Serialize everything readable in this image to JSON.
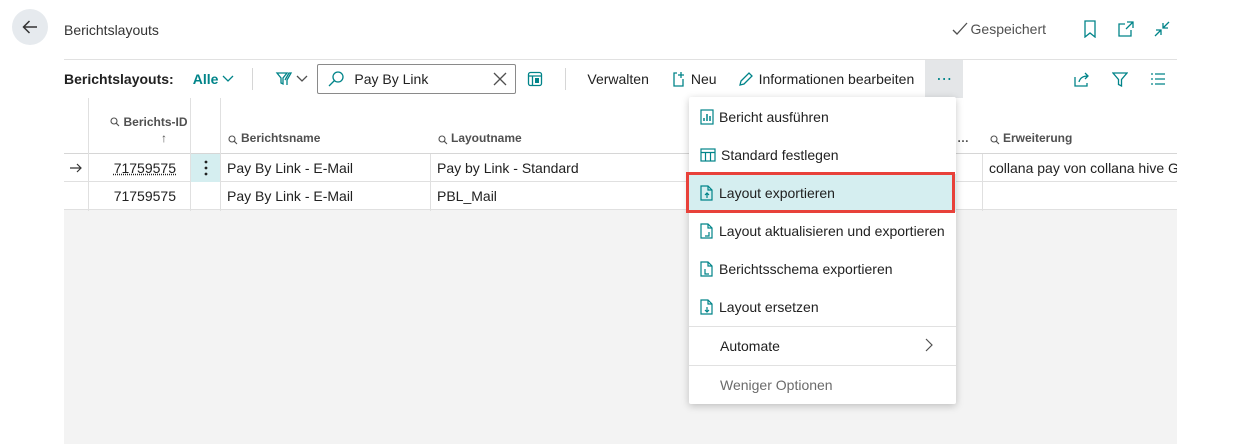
{
  "header": {
    "title": "Berichtslayouts",
    "saved_label": "Gespeichert"
  },
  "toolbar": {
    "label": "Berichtslayouts:",
    "view": "Alle",
    "search_value": "Pay By Link",
    "manage": "Verwalten",
    "new": "Neu",
    "edit_info": "Informationen bearbeiten",
    "more": "⋯"
  },
  "columns": {
    "report_id": "Berichts-ID",
    "report_id_sort": "↑",
    "report_name": "Berichtsname",
    "layout_name": "Layoutname",
    "truncated": "…",
    "extension": "Erweiterung"
  },
  "rows": [
    {
      "report_id": "71759575",
      "report_name": "Pay By Link - E-Mail",
      "layout_name": "Pay by Link - Standard",
      "extension": "collana pay von collana hive G…"
    },
    {
      "report_id": "71759575",
      "report_name": "Pay By Link - E-Mail",
      "layout_name": "PBL_Mail",
      "extension": ""
    }
  ],
  "menu": {
    "items": [
      {
        "label": "Bericht ausführen",
        "icon": "run-report-icon"
      },
      {
        "label": "Standard festlegen",
        "icon": "set-default-icon"
      },
      {
        "label": "Layout exportieren",
        "icon": "export-doc-icon"
      },
      {
        "label": "Layout aktualisieren und exportieren",
        "icon": "update-export-doc-icon"
      },
      {
        "label": "Berichtsschema exportieren",
        "icon": "schema-export-icon"
      },
      {
        "label": "Layout ersetzen",
        "icon": "replace-doc-icon"
      }
    ],
    "automate": "Automate",
    "fewer": "Weniger Optionen"
  },
  "colors": {
    "accent": "#008489",
    "selected_bg": "#d5eef0",
    "highlight_border": "#e8413a"
  }
}
